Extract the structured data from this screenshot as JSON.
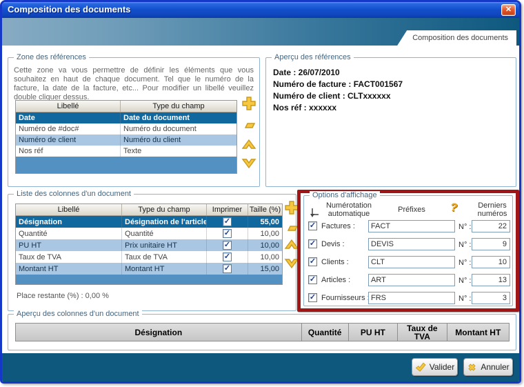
{
  "window": {
    "title": "Composition des documents"
  },
  "tab": {
    "label": "Composition des documents"
  },
  "icons": {
    "close": "✕",
    "check": "✓",
    "help": "?"
  },
  "zone_references": {
    "legend": "Zone des références",
    "description": "Cette zone va vous permettre de définir les éléments que vous souhaitez en haut de chaque document. Tel que le numéro de la facture, la date de la facture, etc... Pour modifier un libellé veuillez double cliquer dessus.",
    "headers": [
      "Libellé",
      "Type du champ"
    ],
    "rows": [
      {
        "libelle": "Date",
        "type": "Date du document",
        "state": "selected"
      },
      {
        "libelle": "Numéro de #doc#",
        "type": "Numéro du document",
        "state": "normal"
      },
      {
        "libelle": "Numéro de client",
        "type": "Numéro du client",
        "state": "alternate"
      },
      {
        "libelle": "Nos réf",
        "type": "Texte",
        "state": "normal"
      }
    ]
  },
  "apercu_references": {
    "legend": "Aperçu des références",
    "lines": [
      "Date : 26/07/2010",
      "Numéro de facture : FACT001567",
      "Numéro de client : CLTxxxxxx",
      "Nos réf : xxxxxx"
    ]
  },
  "liste_colonnes": {
    "legend": "Liste des colonnes d'un document",
    "headers": [
      "Libellé",
      "Type du champ",
      "Imprimer",
      "Taille (%)"
    ],
    "rows": [
      {
        "libelle": "Désignation",
        "type": "Désignation de l'article",
        "imprimer": true,
        "taille": "55,00",
        "state": "selected"
      },
      {
        "libelle": "Quantité",
        "type": "Quantité",
        "imprimer": true,
        "taille": "10,00",
        "state": "normal"
      },
      {
        "libelle": "PU HT",
        "type": "Prix unitaire HT",
        "imprimer": true,
        "taille": "10,00",
        "state": "alternate"
      },
      {
        "libelle": "Taux de TVA",
        "type": "Taux de TVA",
        "imprimer": true,
        "taille": "10,00",
        "state": "normal"
      },
      {
        "libelle": "Montant HT",
        "type": "Montant HT",
        "imprimer": true,
        "taille": "15,00",
        "state": "alternate"
      }
    ],
    "place_restante": "Place restante (%) :  0,00 %"
  },
  "options_affichage": {
    "legend": "Options d'affichage",
    "col_numerotation": "Numérotation automatique",
    "col_prefixes": "Préfixes",
    "col_derniers": "Derniers numéros",
    "numero_label": "N° :",
    "rows": [
      {
        "label": "Factures :",
        "prefix": "FACT",
        "number": "22",
        "checked": true
      },
      {
        "label": "Devis :",
        "prefix": "DEVIS",
        "number": "9",
        "checked": true
      },
      {
        "label": "Clients :",
        "prefix": "CLT",
        "number": "10",
        "checked": true
      },
      {
        "label": "Articles :",
        "prefix": "ART",
        "number": "13",
        "checked": true
      },
      {
        "label": "Fournisseurs :",
        "prefix": "FRS",
        "number": "3",
        "checked": true
      }
    ]
  },
  "apercu_colonnes": {
    "legend": "Aperçu des colonnes d'un document",
    "headers": [
      "Désignation",
      "Quantité",
      "PU HT",
      "Taux de TVA",
      "Montant HT"
    ]
  },
  "footer": {
    "valider": "Valider",
    "annuler": "Annuler"
  },
  "colors": {
    "titlebar_blue": "#1450cc",
    "band_teal": "#0e587e",
    "selected_row": "#11689f",
    "alternate_row": "#a9c7e2",
    "filler_row": "#5391c2",
    "highlight_red": "#a01616",
    "gold": "#f6c73f",
    "footer_teal": "#0e587e"
  }
}
